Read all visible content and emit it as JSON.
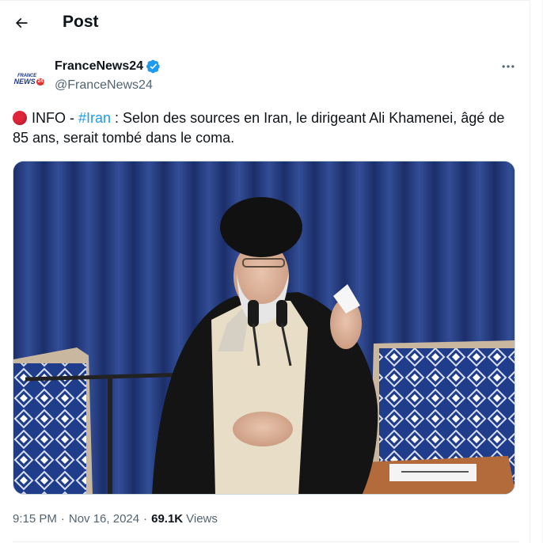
{
  "header": {
    "title": "Post",
    "back_icon": "arrow-left-icon"
  },
  "author": {
    "name": "FranceNews24",
    "handle": "@FranceNews24",
    "verified": true,
    "verified_color": "#1d9bf0",
    "avatar_logo": {
      "line1": "FRANCE",
      "line2": "NEWS",
      "badge": "24"
    }
  },
  "more_icon": "more-horizontal-icon",
  "post": {
    "status_emoji": "red-circle",
    "prefix": "INFO - ",
    "hashtag": "#Iran",
    "text": " : Selon des sources en Iran, le dirigeant Ali Khamenei, âgé de 85 ans, serait tombé dans le coma."
  },
  "media": {
    "alt": ""
  },
  "meta": {
    "time": "9:15 PM",
    "separator": "·",
    "date": "Nov 16, 2024",
    "separator2": "·",
    "views_count": "69.1K",
    "views_label": "Views"
  },
  "colors": {
    "text": "#0f1419",
    "secondary": "#536471",
    "accent": "#1d9bf0",
    "red_dot": "#e0243a"
  }
}
